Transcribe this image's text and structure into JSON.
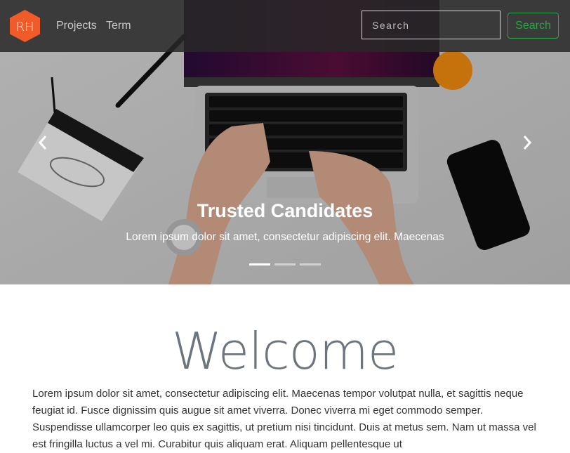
{
  "navbar": {
    "logo_text": "RH",
    "links": [
      "Projects",
      "Term"
    ],
    "search_placeholder": "Search",
    "search_button": "Search",
    "brand_color": "#f15a29",
    "accent_color": "#28a745"
  },
  "carousel": {
    "slide_title": "Trusted Candidates",
    "slide_text": "Lorem ipsum dolor sit amet, consectetur adipiscing elit. Maecenas",
    "slide_count": 3,
    "active_slide": 1
  },
  "content": {
    "heading": "Welcome",
    "paragraph": "Lorem ipsum dolor sit amet, consectetur adipiscing elit. Maecenas tempor volutpat nulla, et sagittis neque feugiat id. Fusce dignissim quis augue sit amet viverra. Donec viverra mi eget commodo semper. Suspendisse ullamcorper leo quis ex sagittis, ut pretium nisi tincidunt. Duis at metus sem. Nam ut massa vel est fringilla luctus a vel mi. Curabitur quis aliquam erat. Aliquam pellentesque ut"
  }
}
